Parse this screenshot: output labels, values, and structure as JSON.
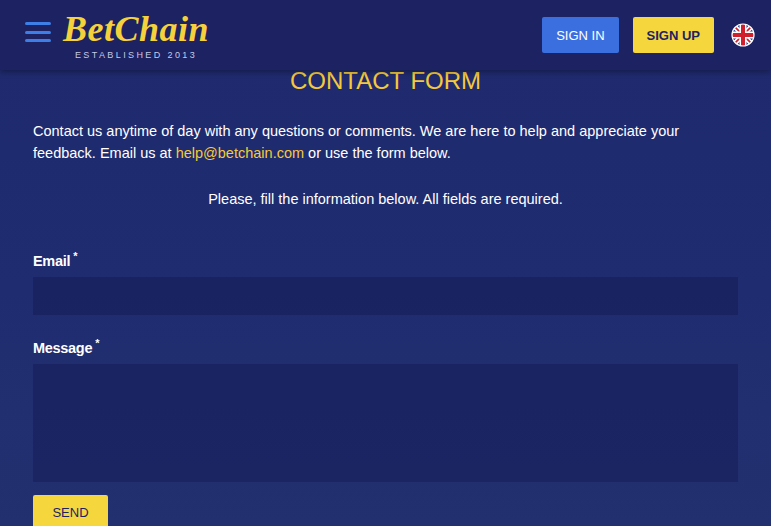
{
  "header": {
    "logo": "BetChain",
    "logo_tagline": "ESTABLISHED 2013",
    "buttons": [
      {
        "label": "SIGN IN",
        "kind": "secondary"
      },
      {
        "label": "SIGN UP",
        "kind": "primary"
      }
    ]
  },
  "form": {
    "title": "CONTACT FORM",
    "intro_before": "Contact us anytime of day with any questions or comments. We are here to help and appreciate your feedback. Email us at ",
    "email_link": "help@betchain.com",
    "intro_after": " or use the form below.",
    "instruction": "Please, fill the information below. All fields are required.",
    "fields": [
      {
        "label": "Email",
        "required_mark": "*",
        "kind": "input",
        "value": ""
      },
      {
        "label": "Message",
        "required_mark": "*",
        "kind": "textarea",
        "value": ""
      }
    ],
    "submit": "SEND"
  }
}
